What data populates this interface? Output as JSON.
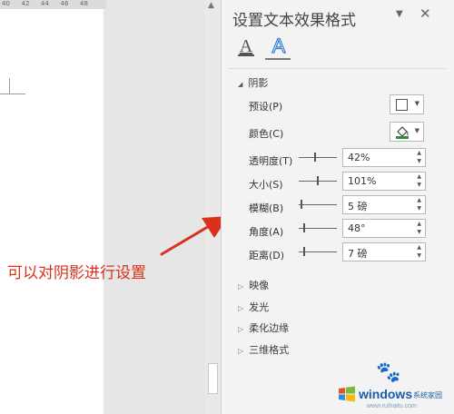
{
  "ruler": {
    "ticks": [
      "40",
      "42",
      "44",
      "46",
      "48"
    ]
  },
  "annotation": {
    "text": "可以对阴影进行设置",
    "color": "#d9311b"
  },
  "pane": {
    "title": "设置文本效果格式",
    "dropdown_icon": "chevron-down-icon",
    "close_icon": "close-icon",
    "tabs": [
      {
        "name": "text-fill-outline",
        "icon": "text-fill-icon",
        "glyph": "A",
        "selected": false
      },
      {
        "name": "text-effects",
        "icon": "text-effect-icon",
        "glyph": "A",
        "selected": true
      }
    ],
    "shadow": {
      "label": "阴影",
      "expanded": true,
      "preset_label": "预设(P)",
      "color_label": "颜色(C)",
      "transparency_label": "透明度(T)",
      "transparency_value": "42%",
      "transparency_level": 0.42,
      "size_label": "大小(S)",
      "size_value": "101%",
      "size_level": 0.5,
      "blur_label": "模糊(B)",
      "blur_value": "5 磅",
      "blur_level": 0.05,
      "angle_label": "角度(A)",
      "angle_value": "48°",
      "angle_level": 0.13,
      "distance_label": "距离(D)",
      "distance_value": "7 磅",
      "distance_level": 0.12
    },
    "collapsed_sections": [
      "映像",
      "发光",
      "柔化边缘",
      "三维格式"
    ]
  },
  "watermark": {
    "brand": "windows",
    "brand_cn": "系统家园",
    "url": "www.ruihaitu.com"
  }
}
